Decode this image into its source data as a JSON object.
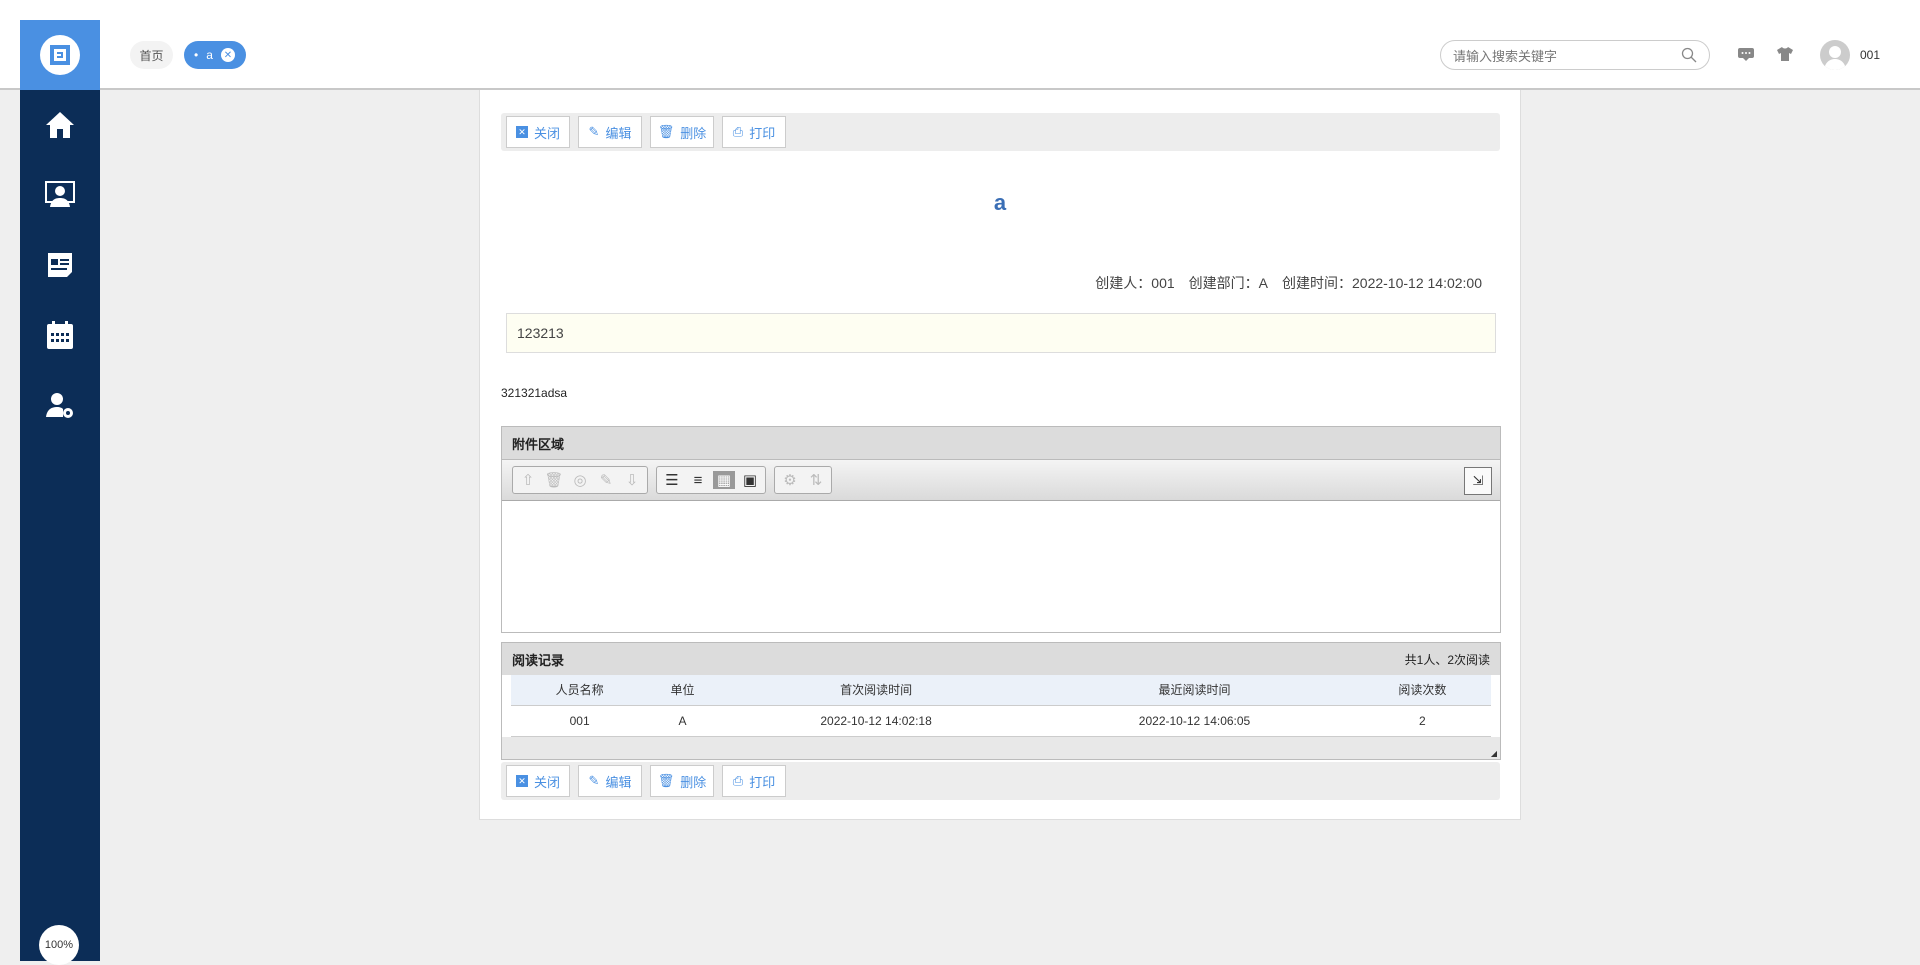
{
  "header": {
    "tabs": [
      {
        "label": "首页"
      },
      {
        "label": "a"
      }
    ],
    "search_placeholder": "请输入搜索关键字",
    "user": "001"
  },
  "sidebar": {
    "items": [
      "home",
      "monitor-user",
      "news",
      "calendar",
      "user-settings"
    ],
    "zoom": "100%"
  },
  "toolbar": {
    "close": "关闭",
    "edit": "编辑",
    "delete": "删除",
    "print": "打印"
  },
  "doc": {
    "title": "a",
    "creator_label": "创建人：001",
    "dept_label": "创建部门：A",
    "time_label": "创建时间：2022-10-12 14:02:00",
    "summary": "123213",
    "body": "321321adsa"
  },
  "attachments": {
    "title": "附件区域"
  },
  "reads": {
    "title": "阅读记录",
    "summary": "共1人、2次阅读",
    "columns": [
      "人员名称",
      "单位",
      "首次阅读时间",
      "最近阅读时间",
      "阅读次数"
    ],
    "rows": [
      [
        "001",
        "A",
        "2022-10-12 14:02:18",
        "2022-10-12 14:06:05",
        "2"
      ]
    ]
  },
  "colors": {
    "accent": "#4a90e2",
    "sidebar": "#0c2d57"
  }
}
